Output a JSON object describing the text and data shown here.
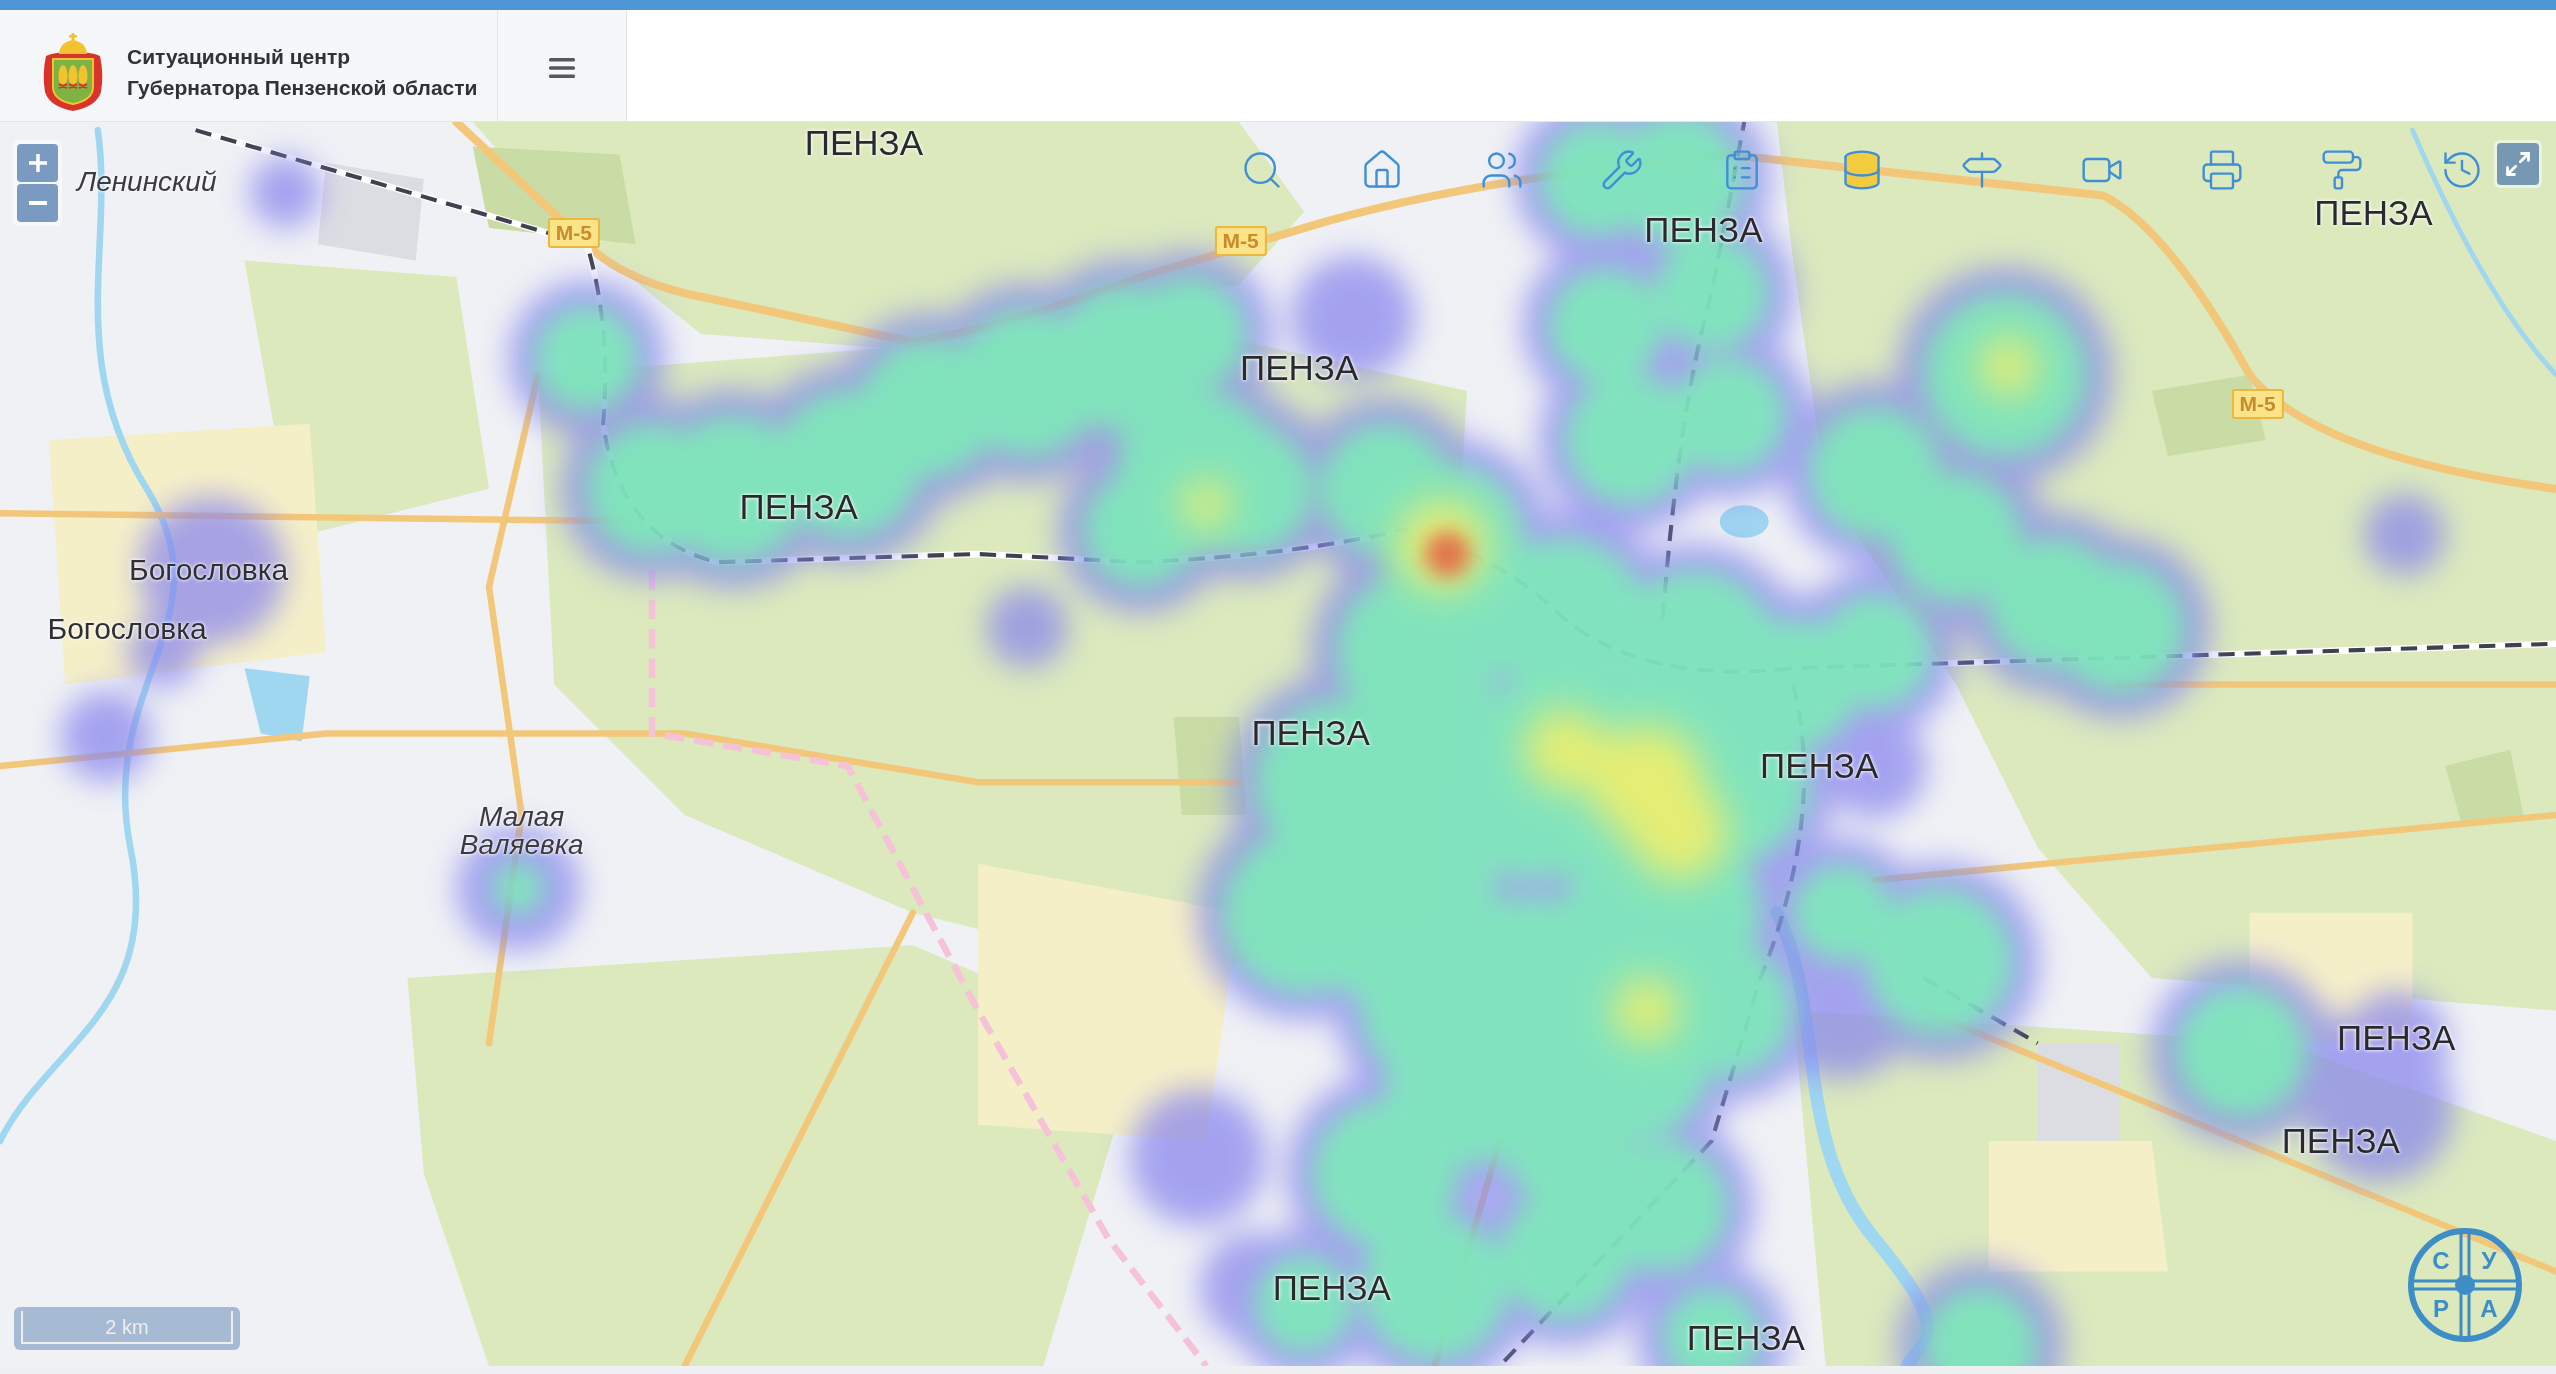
{
  "header": {
    "title": "Ситуационный центр",
    "subtitle": "Губернатора Пензенской области"
  },
  "toolbar": {
    "tools": [
      {
        "selected": false
      },
      {
        "selected": false
      },
      {
        "selected": false
      },
      {
        "selected": false
      },
      {
        "selected": false
      },
      {
        "selected": true
      },
      {
        "selected": false
      },
      {
        "selected": false
      },
      {
        "selected": false
      },
      {
        "selected": false
      },
      {
        "selected": false
      }
    ]
  },
  "map": {
    "labels": [
      {
        "kind": "city",
        "text": "ПЕНЗА"
      },
      {
        "kind": "locality",
        "text": "Ленинский"
      },
      {
        "kind": "city",
        "text": "ПЕНЗА"
      },
      {
        "kind": "city",
        "text": "ПЕНЗА"
      },
      {
        "kind": "city",
        "text": "ПЕНЗА"
      },
      {
        "kind": "city",
        "text": "ПЕНЗА"
      },
      {
        "kind": "village",
        "text": "Богословка"
      },
      {
        "kind": "village",
        "text": "Богословка"
      },
      {
        "kind": "city",
        "text": "ПЕНЗА"
      },
      {
        "kind": "city",
        "text": "ПЕНЗА"
      },
      {
        "kind": "locality",
        "text": "Малая Валяевка"
      },
      {
        "kind": "city",
        "text": "ПЕНЗА"
      },
      {
        "kind": "city",
        "text": "ПЕНЗА"
      },
      {
        "kind": "city",
        "text": "ПЕНЗА"
      },
      {
        "kind": "city",
        "text": "ПЕНЗА"
      }
    ],
    "route_signs": [
      {
        "text": "М-5"
      },
      {
        "text": "М-5"
      },
      {
        "text": "М-5"
      }
    ],
    "scale": {
      "text": "2 km"
    }
  },
  "logo": {
    "letters": [
      "С",
      "У",
      "Р",
      "А"
    ]
  }
}
